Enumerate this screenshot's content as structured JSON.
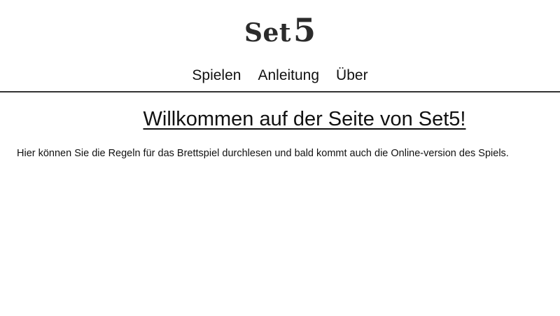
{
  "logo": {
    "word": "Set",
    "number": "5"
  },
  "nav": {
    "items": [
      {
        "label": "Spielen"
      },
      {
        "label": "Anleitung"
      },
      {
        "label": "Über"
      }
    ]
  },
  "main": {
    "headline": "Willkommen auf der Seite von Set5!",
    "intro": "Hier können Sie die Regeln für das Brettspiel durchlesen und bald kommt auch die Online-version des Spiels."
  }
}
